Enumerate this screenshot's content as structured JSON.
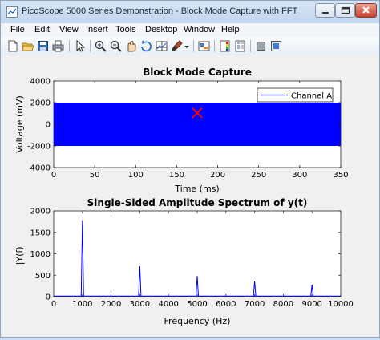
{
  "window": {
    "title": "PicoScope 5000 Series Demonstration - Block Mode Capture with FFT",
    "icon": "matlab-figure-icon",
    "controls": [
      "minimize-icon",
      "maximize-icon",
      "close-icon"
    ]
  },
  "menu": {
    "items": [
      "File",
      "Edit",
      "View",
      "Insert",
      "Tools",
      "Desktop",
      "Window",
      "Help"
    ]
  },
  "toolbar": {
    "buttons": [
      "new-figure-icon",
      "open-file-icon",
      "save-icon",
      "print-icon",
      "pointer-icon",
      "zoom-in-icon",
      "zoom-out-icon",
      "pan-icon",
      "rotate-icon",
      "data-cursor-icon",
      "brush-icon",
      "brush-dropdown-icon",
      "link-plot-icon",
      "colorbar-icon",
      "legend-icon",
      "hide-plot-tools-icon",
      "show-plot-tools-icon"
    ]
  },
  "colors": {
    "series": "#0000ff",
    "marker": "#ff0000",
    "axes_bg": "#ffffff",
    "figure_bg": "#f0f0f0"
  },
  "chart_data": [
    {
      "type": "line",
      "title": "Block Mode Capture",
      "xlabel": "Time (ms)",
      "ylabel": "Voltage (mV)",
      "xlim": [
        0,
        350
      ],
      "ylim": [
        -4000,
        4000
      ],
      "xticks": [
        "0",
        "50",
        "100",
        "150",
        "200",
        "250",
        "300",
        "350"
      ],
      "yticks": [
        "4000",
        "2000",
        "0",
        "-2000",
        "-4000"
      ],
      "series": [
        {
          "name": "Channel A",
          "band_min": -2000,
          "band_max": 2000,
          "x_range": [
            0,
            350
          ]
        }
      ],
      "annotations": [
        {
          "marker": "x",
          "x": 175,
          "y": 1050
        }
      ],
      "legend": "top-right",
      "grid": false
    },
    {
      "type": "line",
      "title": "Single-Sided Amplitude Spectrum of y(t)",
      "xlabel": "Frequency (Hz)",
      "ylabel": "|Y(f)|",
      "xlim": [
        0,
        10000
      ],
      "ylim": [
        0,
        2000
      ],
      "xticks": [
        "0",
        "1000",
        "2000",
        "3000",
        "4000",
        "5000",
        "6000",
        "7000",
        "8000",
        "9000",
        "10000"
      ],
      "yticks": [
        "2000",
        "1500",
        "1000",
        "500",
        "0"
      ],
      "peaks": [
        {
          "x": 1000,
          "y": 1780
        },
        {
          "x": 3000,
          "y": 710
        },
        {
          "x": 5000,
          "y": 480
        },
        {
          "x": 7000,
          "y": 360
        },
        {
          "x": 9000,
          "y": 280
        }
      ],
      "grid": false
    }
  ]
}
